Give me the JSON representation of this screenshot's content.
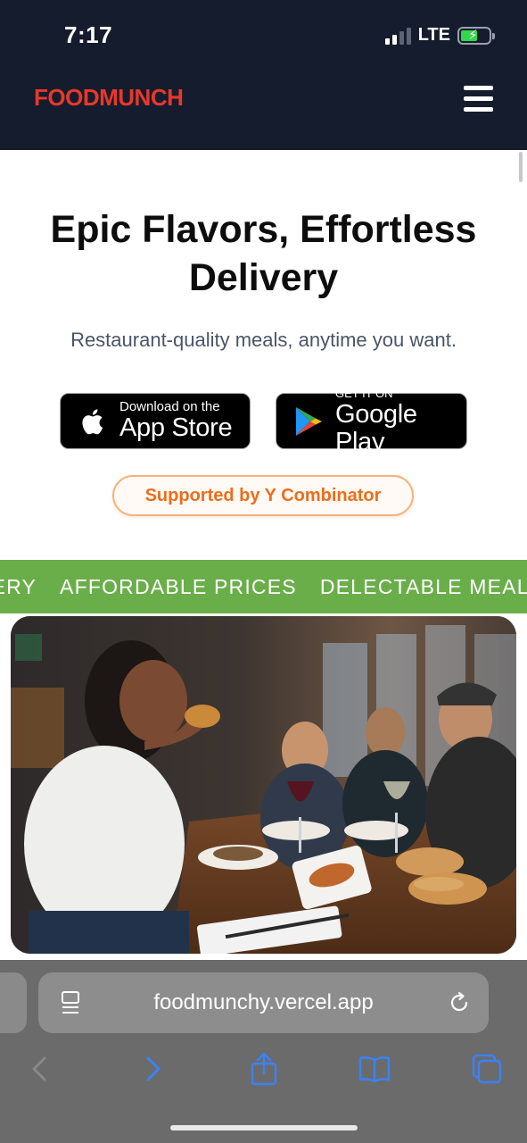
{
  "status_bar": {
    "time": "7:17",
    "network": "LTE"
  },
  "header": {
    "brand": "FOODMUNCH",
    "menu_icon": "hamburger-menu-icon"
  },
  "hero": {
    "title": "Epic Flavors, Effortless Delivery",
    "subtitle": "Restaurant-quality meals, anytime you want."
  },
  "app_store": {
    "small": "Download on the",
    "big": "App Store"
  },
  "google_play": {
    "small": "GET IT ON",
    "big": "Google Play"
  },
  "badge": {
    "label": "Supported by Y Combinator"
  },
  "marquee": {
    "items": [
      "VERY",
      "AFFORDABLE PRICES",
      "DELECTABLE MEALS"
    ]
  },
  "browser": {
    "url": "foodmunchy.vercel.app"
  },
  "colors": {
    "header_bg": "#151c2e",
    "brand": "#e8382a",
    "marquee_bg": "#6aae4a",
    "badge_accent": "#ef6c1a",
    "browser_bg": "#6b6b6b",
    "link_blue": "#3b82f6"
  }
}
